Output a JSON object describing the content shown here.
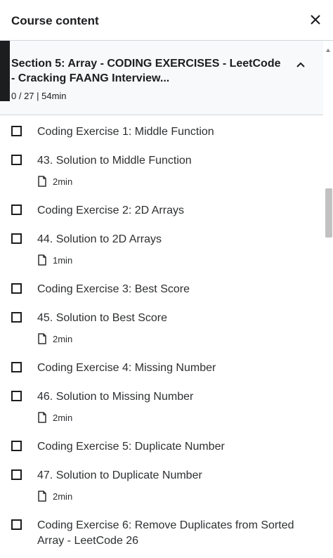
{
  "header": {
    "title": "Course content"
  },
  "section": {
    "title": "Section 5: Array - CODING EXERCISES - LeetCode - Cracking FAANG Interview...",
    "meta": "0 / 27 | 54min"
  },
  "items": [
    {
      "type": "exercise",
      "title": "Coding Exercise 1: Middle Function"
    },
    {
      "type": "lecture",
      "title": "43. Solution to Middle Function",
      "duration": "2min"
    },
    {
      "type": "exercise",
      "title": "Coding Exercise 2: 2D Arrays"
    },
    {
      "type": "lecture",
      "title": "44. Solution to 2D Arrays",
      "duration": "1min"
    },
    {
      "type": "exercise",
      "title": "Coding Exercise 3: Best Score"
    },
    {
      "type": "lecture",
      "title": "45. Solution to Best Score",
      "duration": "2min"
    },
    {
      "type": "exercise",
      "title": "Coding Exercise 4: Missing Number"
    },
    {
      "type": "lecture",
      "title": "46. Solution to Missing Number",
      "duration": "2min"
    },
    {
      "type": "exercise",
      "title": "Coding Exercise 5: Duplicate Number"
    },
    {
      "type": "lecture",
      "title": "47. Solution to Duplicate Number",
      "duration": "2min"
    },
    {
      "type": "exercise",
      "title": "Coding Exercise 6: Remove Duplicates from Sorted Array - LeetCode 26"
    }
  ],
  "icons": {
    "close": "close-icon",
    "collapse": "chevron-up-icon",
    "duration": "file-icon"
  }
}
